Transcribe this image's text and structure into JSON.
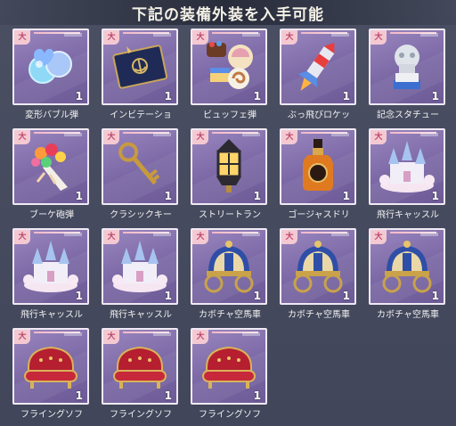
{
  "header": {
    "title": "下記の装備外装を入手可能"
  },
  "items": [
    {
      "name": "変形バブル弾",
      "qty": "1",
      "icon": "bubble-icon",
      "badge": "大"
    },
    {
      "name": "インビテーショ",
      "qty": "1",
      "icon": "invitation-card-icon",
      "badge": "大"
    },
    {
      "name": "ビュッフェ弾",
      "qty": "1",
      "icon": "buffet-dessert-icon",
      "badge": "大"
    },
    {
      "name": "ぶっ飛びロケッ",
      "qty": "1",
      "icon": "rocket-icon",
      "badge": "大"
    },
    {
      "name": "記念スタチュー",
      "qty": "1",
      "icon": "statue-icon",
      "badge": "大"
    },
    {
      "name": "ブーケ砲弾",
      "qty": "1",
      "icon": "bouquet-icon",
      "badge": "大"
    },
    {
      "name": "クラシックキー",
      "qty": "1",
      "icon": "key-icon",
      "badge": "大"
    },
    {
      "name": "ストリートラン",
      "qty": "1",
      "icon": "lantern-icon",
      "badge": "大"
    },
    {
      "name": "ゴージャスドリ",
      "qty": "1",
      "icon": "bottle-icon",
      "badge": "大"
    },
    {
      "name": "飛行キャッスル",
      "qty": "1",
      "icon": "castle-icon",
      "badge": "大"
    },
    {
      "name": "飛行キャッスル",
      "qty": "1",
      "icon": "castle-icon",
      "badge": "大"
    },
    {
      "name": "飛行キャッスル",
      "qty": "1",
      "icon": "castle-icon",
      "badge": "大"
    },
    {
      "name": "カボチャ空馬車",
      "qty": "1",
      "icon": "carriage-icon",
      "badge": "大"
    },
    {
      "name": "カボチャ空馬車",
      "qty": "1",
      "icon": "carriage-icon",
      "badge": "大"
    },
    {
      "name": "カボチャ空馬車",
      "qty": "1",
      "icon": "carriage-icon",
      "badge": "大"
    },
    {
      "name": "フライングソフ",
      "qty": "1",
      "icon": "sofa-icon",
      "badge": "大"
    },
    {
      "name": "フライングソフ",
      "qty": "1",
      "icon": "sofa-icon",
      "badge": "大"
    },
    {
      "name": "フライングソフ",
      "qty": "1",
      "icon": "sofa-icon",
      "badge": "大"
    }
  ]
}
